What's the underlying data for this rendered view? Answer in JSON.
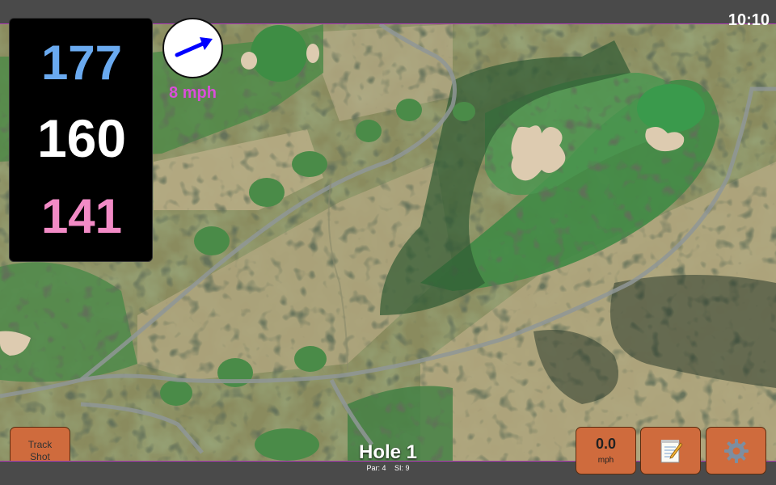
{
  "status": {
    "time": "10:10"
  },
  "distances": {
    "back": "177",
    "middle": "160",
    "front": "141",
    "colors": {
      "back": "#6aaaf0",
      "middle": "#ffffff",
      "front": "#f28bc6"
    }
  },
  "wind": {
    "speed_label": "8 mph",
    "arrow_icon": "wind-arrow-icon",
    "arrow_color": "#0000ff",
    "label_color": "#d94fd9"
  },
  "buttons": {
    "track_shot": {
      "line1": "Track",
      "line2": "Shot"
    },
    "speed": {
      "value": "0.0",
      "unit": "mph"
    },
    "scorecard": {
      "icon": "notepad-icon"
    },
    "settings": {
      "icon": "gear-icon"
    },
    "button_color": "#cf6b3d"
  },
  "hole": {
    "title": "Hole 1",
    "par_label": "Par: 4",
    "si_label": "SI: 9"
  },
  "map": {
    "view": "satellite",
    "features": [
      "fairway",
      "green",
      "bunker",
      "cart-path",
      "trees"
    ]
  }
}
